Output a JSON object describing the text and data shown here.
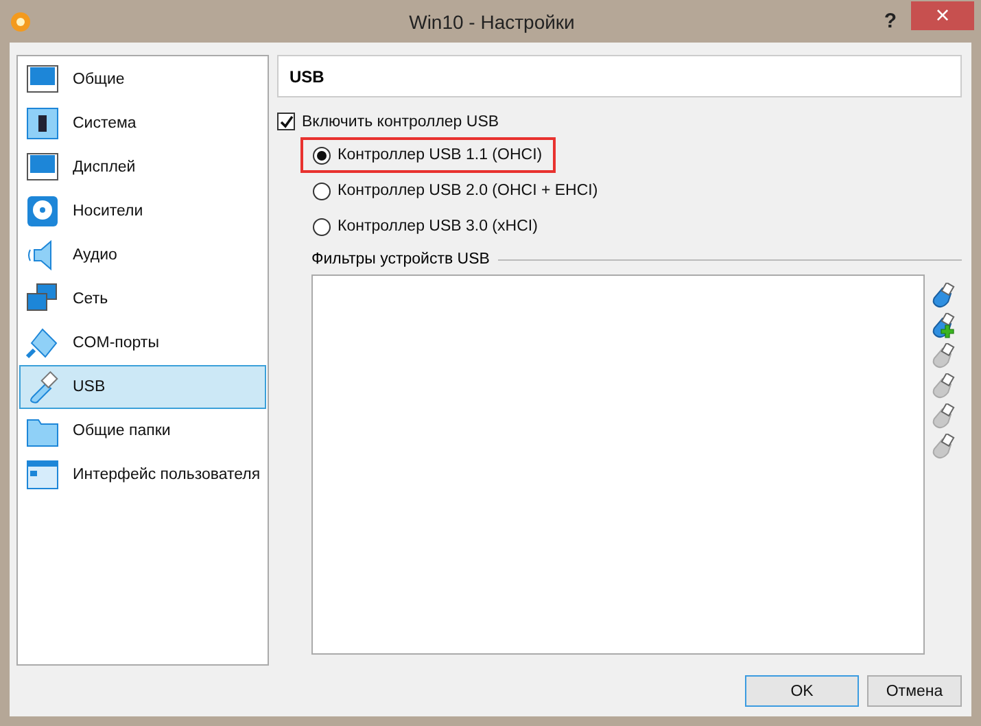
{
  "window": {
    "title": "Win10 - Настройки",
    "help": "?",
    "close": "×"
  },
  "sidebar": {
    "items": [
      {
        "label": "Общие",
        "kind": "monitor",
        "selected": false
      },
      {
        "label": "Система",
        "kind": "chip",
        "selected": false
      },
      {
        "label": "Дисплей",
        "kind": "monitor",
        "selected": false
      },
      {
        "label": "Носители",
        "kind": "disk",
        "selected": false
      },
      {
        "label": "Аудио",
        "kind": "speaker",
        "selected": false
      },
      {
        "label": "Сеть",
        "kind": "network",
        "selected": false
      },
      {
        "label": "COM-порты",
        "kind": "serial",
        "selected": false
      },
      {
        "label": "USB",
        "kind": "usb",
        "selected": true
      },
      {
        "label": "Общие папки",
        "kind": "folder",
        "selected": false
      },
      {
        "label": "Интерфейс пользователя",
        "kind": "window",
        "selected": false
      }
    ]
  },
  "page": {
    "title": "USB",
    "enable": {
      "label": "Включить контроллер USB",
      "checked": true
    },
    "controllers": [
      {
        "label": "Контроллер USB 1.1 (OHCI)",
        "selected": true,
        "highlighted": true
      },
      {
        "label": "Контроллер USB 2.0 (OHCI + EHCI)",
        "selected": false,
        "highlighted": false
      },
      {
        "label": "Контроллер USB 3.0 (xHCI)",
        "selected": false,
        "highlighted": false
      }
    ],
    "filters": {
      "title": "Фильтры устройств USB",
      "tools": [
        {
          "kind": "plain",
          "disabled": false
        },
        {
          "kind": "plus",
          "disabled": false
        },
        {
          "kind": "plain",
          "disabled": true
        },
        {
          "kind": "plain",
          "disabled": true
        },
        {
          "kind": "plain",
          "disabled": true
        },
        {
          "kind": "plain",
          "disabled": true
        }
      ]
    }
  },
  "buttons": [
    {
      "label": "OK",
      "default": true
    },
    {
      "label": "Отмена",
      "default": false
    }
  ]
}
